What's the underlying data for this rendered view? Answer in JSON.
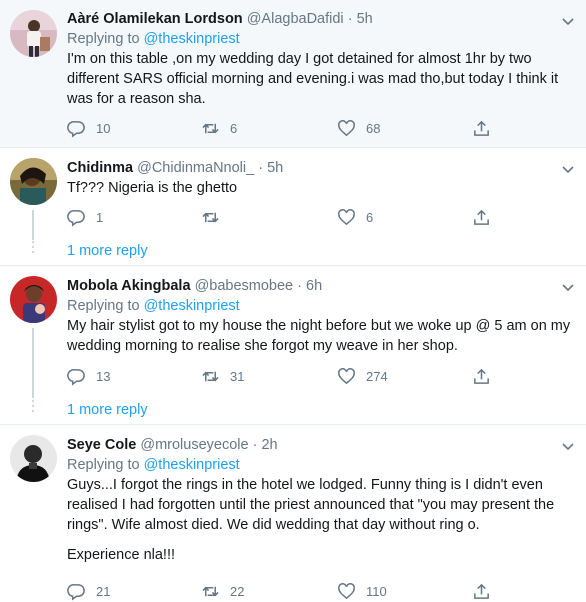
{
  "tweets": [
    {
      "name": "Aàré Olamilekan Lordson",
      "handle": "@AlagbaDafidi",
      "time": "5h",
      "reply_prefix": "Replying to",
      "reply_to": "@theskinpriest",
      "text": "I'm on this table ,on my wedding day I got detained for almost 1hr by two different SARS official morning and evening.i was mad tho,but today I think it was for a reason sha.",
      "replies": "10",
      "retweets": "6",
      "likes": "68"
    },
    {
      "name": "Chidinma",
      "handle": "@ChidinmaNnoli_",
      "time": "5h",
      "text": "Tf??? Nigeria is the ghetto",
      "replies": "1",
      "retweets": "",
      "likes": "6",
      "more_replies": "1 more reply"
    },
    {
      "name": "Mobola Akingbala",
      "handle": "@babesmobee",
      "time": "6h",
      "reply_prefix": "Replying to",
      "reply_to": "@theskinpriest",
      "text": "My hair stylist got to my house the night before but we woke up @ 5 am on my wedding morning to realise she forgot my weave in her shop.",
      "replies": "13",
      "retweets": "31",
      "likes": "274",
      "more_replies": "1 more reply"
    },
    {
      "name": "Seye Cole",
      "handle": "@mroluseyecole",
      "time": "2h",
      "reply_prefix": "Replying to",
      "reply_to": "@theskinpriest",
      "text": "Guys...I forgot the rings in the hotel we lodged. Funny thing is I didn't even realised I had forgotten until the priest announced that \"you may present the rings\". Wife almost died. We did wedding that day without ring o.",
      "text2": "Experience nla!!!",
      "replies": "21",
      "retweets": "22",
      "likes": "110"
    }
  ],
  "separator": "·",
  "colors": {
    "accent": "#1da1f2",
    "secondary": "#657786",
    "highlight_bg": "#f5f8fa",
    "border": "#e6ecf0"
  },
  "icons": [
    "reply-icon",
    "retweet-icon",
    "like-icon",
    "share-icon",
    "chevron-down-icon"
  ]
}
